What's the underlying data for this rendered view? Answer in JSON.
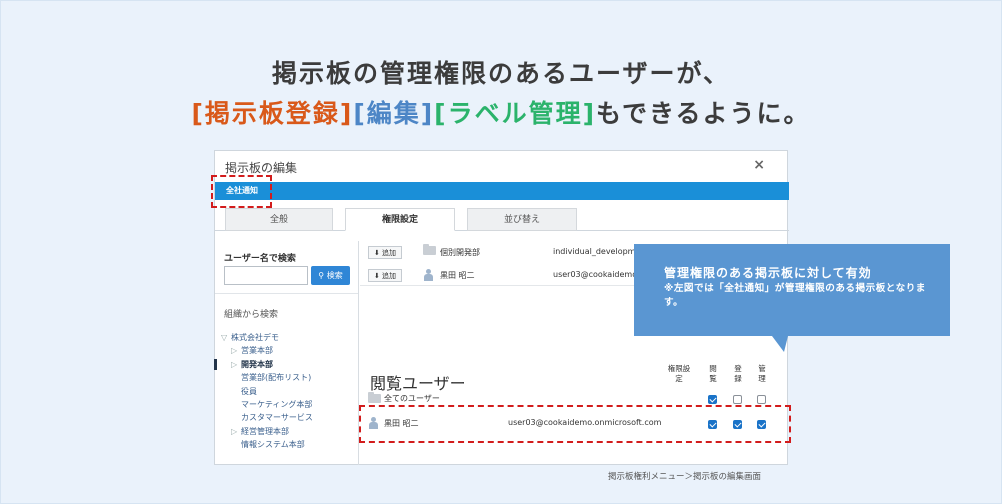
{
  "headline": {
    "line1": "掲示板の管理権限のあるユーザーが、",
    "seg1": "[掲示板登録]",
    "seg2": "[編集]",
    "seg3": "[ラベル管理]",
    "tail": "もできるように。"
  },
  "dialog": {
    "title": "掲示板の編集",
    "close": "×",
    "bar_label": "全社通知",
    "tabs": [
      {
        "label": "全般",
        "active": false
      },
      {
        "label": "権限設定",
        "active": true
      },
      {
        "label": "並び替え",
        "active": false
      }
    ]
  },
  "left_pane": {
    "search_title": "ユーザー名で検索",
    "search_placeholder": "",
    "search_button": "検索",
    "org_title": "組織から検索",
    "tree": [
      {
        "label": "株式会社デモ",
        "arrow": "▽"
      },
      {
        "label": "営業本部",
        "arrow": "▷"
      },
      {
        "label": "開発本部",
        "arrow": "▷"
      },
      {
        "label": "営業部(配布リスト)",
        "arrow": ""
      },
      {
        "label": "役員",
        "arrow": ""
      },
      {
        "label": "マーケティング本部",
        "arrow": ""
      },
      {
        "label": "カスタマーサービス",
        "arrow": ""
      },
      {
        "label": "経営管理本部",
        "arrow": "▷"
      },
      {
        "label": "情報システム本部",
        "arrow": ""
      }
    ]
  },
  "add_list": [
    {
      "button": "追加",
      "icon": "folder-icon",
      "name": "個別開発部",
      "email": "individual_developm"
    },
    {
      "button": "追加",
      "icon": "person-icon",
      "name": "黒田 昭二",
      "email": "user03@cookaidemo"
    }
  ],
  "permissions": {
    "header_label": "閲覧ユーザー",
    "col_setting": "権限設定",
    "col_view": "閲覧",
    "col_register": "登録",
    "col_manage": "管理",
    "rows": [
      {
        "icon": "folder-icon",
        "name": "全てのユーザー",
        "email": "",
        "view": true,
        "register": false,
        "manage": false
      },
      {
        "icon": "person-icon",
        "name": "黒田 昭二",
        "email": "user03@cookaidemo.onmicrosoft.com",
        "view": true,
        "register": true,
        "manage": true
      }
    ]
  },
  "callout": {
    "title": "管理権限のある掲示板に対して有効",
    "note": "※左図では「全社通知」が管理権限のある掲示板となります。"
  },
  "caption": "掲示板権利メニュー＞掲示板の編集画面",
  "colors": {
    "accent_blue": "#1a8fd8",
    "headline_orange": "#d9591a",
    "headline_blue": "#4d86c6",
    "headline_green": "#2bb36b",
    "highlight_red": "#d21c1c",
    "callout_bg": "#5a96d2"
  }
}
